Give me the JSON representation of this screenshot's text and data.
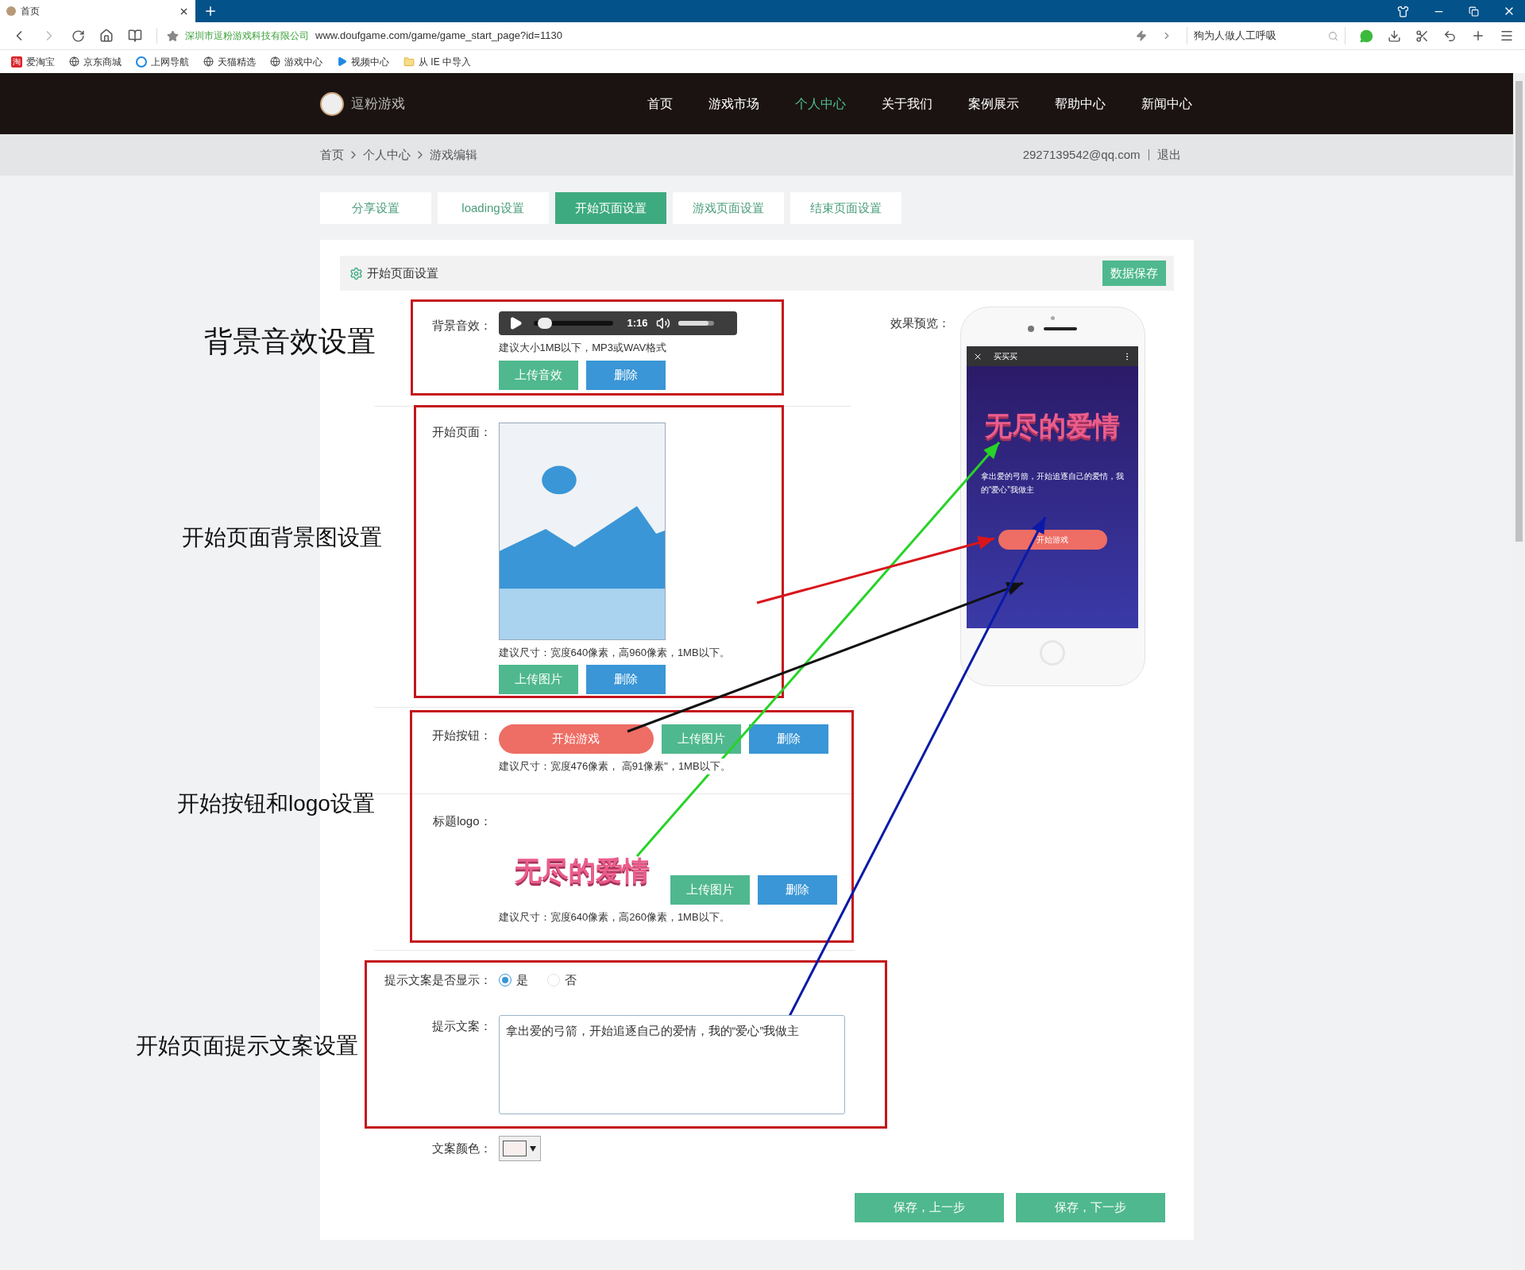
{
  "browser": {
    "tab_title": "首页",
    "site_name": "深圳市逗粉游戏科技有限公司",
    "url": "www.doufgame.com/game/game_start_page?id=1130",
    "search_value": "狗为人做人工呼吸",
    "bookmarks": [
      {
        "kind": "badge",
        "badge": "淘",
        "label": "爱淘宝"
      },
      {
        "kind": "globe",
        "label": "京东商城"
      },
      {
        "kind": "ie",
        "label": "上网导航"
      },
      {
        "kind": "globe",
        "label": "天猫精选"
      },
      {
        "kind": "globe",
        "label": "游戏中心"
      },
      {
        "kind": "video",
        "label": "视频中心"
      },
      {
        "kind": "folder",
        "label": "从 IE 中导入"
      }
    ]
  },
  "nav": {
    "brand": "逗粉游戏",
    "items": [
      {
        "label": "首页",
        "selected": false
      },
      {
        "label": "游戏市场",
        "selected": false
      },
      {
        "label": "个人中心",
        "selected": true
      },
      {
        "label": "关于我们",
        "selected": false
      },
      {
        "label": "案例展示",
        "selected": false
      },
      {
        "label": "帮助中心",
        "selected": false
      },
      {
        "label": "新闻中心",
        "selected": false
      }
    ]
  },
  "breadcrumb": {
    "items": [
      "首页",
      "个人中心",
      "游戏编辑"
    ],
    "email": "2927139542@qq.com",
    "logout": "退出"
  },
  "tabs": [
    {
      "label": "分享设置",
      "selected": false
    },
    {
      "label": "loading设置",
      "selected": false
    },
    {
      "label": "开始页面设置",
      "selected": true
    },
    {
      "label": "游戏页面设置",
      "selected": false
    },
    {
      "label": "结束页面设置",
      "selected": false
    }
  ],
  "panel": {
    "title": "开始页面设置",
    "save_button": "数据保存"
  },
  "form": {
    "audio": {
      "label": "背景音效：",
      "time": "1:16",
      "progress": {
        "level": 0.05
      },
      "volume": {
        "level": 0.85
      },
      "hint": "建议大小1MB以下，MP3或WAV格式",
      "buttons": [
        "上传音效",
        "删除"
      ]
    },
    "start_page": {
      "label": "开始页面：",
      "hint": "建议尺寸：宽度640像素，高960像素，1MB以下。",
      "buttons": [
        "上传图片",
        "删除"
      ]
    },
    "start_button": {
      "label": "开始按钮：",
      "button_text": "开始游戏",
      "buttons": [
        "上传图片",
        "删除"
      ],
      "hint": "建议尺寸：宽度476像素， 高91像素\"，1MB以下。"
    },
    "title_logo": {
      "label": "标题logo：",
      "logo_text": "无尽的爱情",
      "buttons": [
        "上传图片",
        "删除"
      ],
      "hint": "建议尺寸：宽度640像素，高260像素，1MB以下。"
    },
    "tip_display": {
      "label": "提示文案是否显示：",
      "options": [
        {
          "label": "是",
          "selected": true
        },
        {
          "label": "否",
          "selected": false
        }
      ]
    },
    "tip_text": {
      "label": "提示文案：",
      "value": "拿出爱的弓箭，开始追逐自己的爱情，我的“爱心”我做主"
    },
    "text_color": {
      "label": "文案颜色："
    }
  },
  "preview": {
    "label": "效果预览：",
    "screen_title": "买买买",
    "logo_text": "无尽的爱情",
    "tip": "拿出爱的弓箭，开始追逐自己的爱情，我的“爱心”我做主",
    "start_button": "开始游戏"
  },
  "footer_buttons": [
    "保存，上一步",
    "保存，下一步"
  ],
  "annotations": [
    "背景音效设置",
    "开始页面背景图设置",
    "开始按钮和logo设置",
    "开始页面提示文案设置"
  ]
}
